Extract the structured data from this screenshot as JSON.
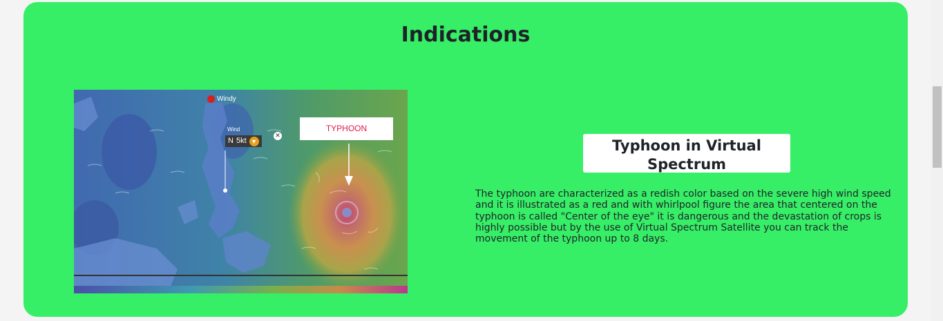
{
  "section": {
    "title": "Indications"
  },
  "map": {
    "brand": "Windy",
    "callout_label": "TYPHOON",
    "wind_label": "Wind",
    "wind_value": "5kt",
    "wind_direction": "N",
    "accent_red": "#e0184c",
    "icons": [
      "windy-logo-icon",
      "chevron-down-icon",
      "close-icon",
      "arrow-down-icon"
    ]
  },
  "feature": {
    "heading": "Typhoon in Virtual Spectrum",
    "description": "The typhoon are characterized as a redish color based on the severe high wind speed and it is illustrated as a red and with whirlpool figure the area that centered on the typhoon is called \"Center of the eye\" it is dangerous and the devastation of crops is highly possible but by the use of Virtual Spectrum Satellite you can track the movement of the typhoon up to 8 days."
  },
  "colors": {
    "card_background": "#37ee67",
    "page_background": "#f4f4f4",
    "text": "#1f2328"
  }
}
